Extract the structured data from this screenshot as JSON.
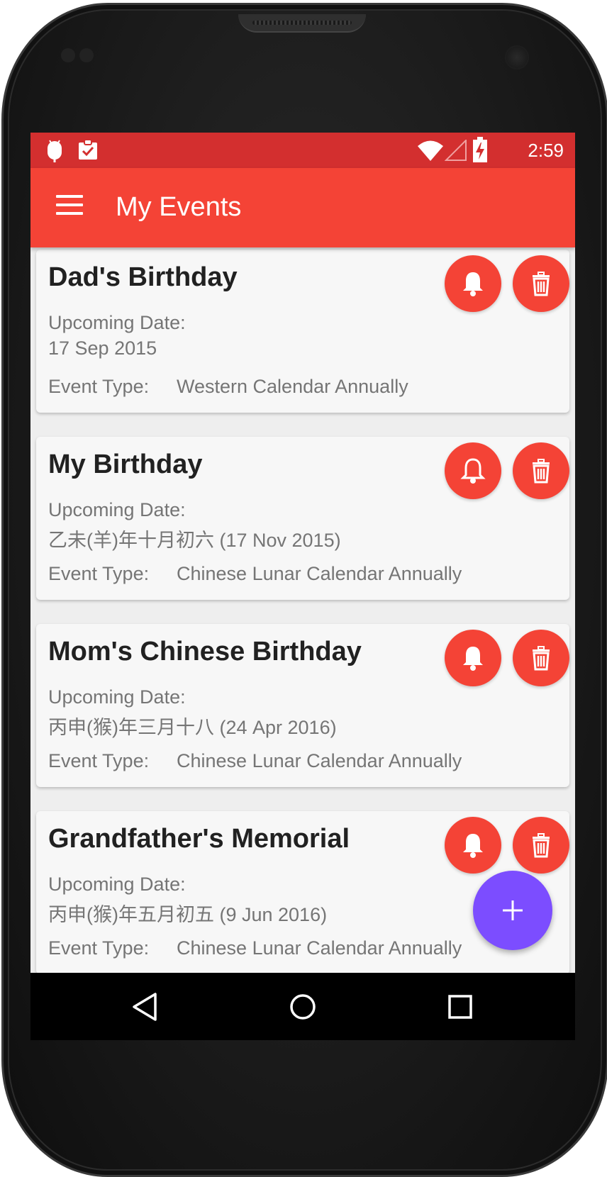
{
  "status_bar": {
    "time": "2:59",
    "icons": [
      "android-debug-icon",
      "clipboard-check-icon",
      "wifi-icon",
      "signal-icon",
      "battery-charging-icon"
    ]
  },
  "app_bar": {
    "title": "My Events",
    "menu_icon": "hamburger-menu-icon"
  },
  "events": [
    {
      "title": "Dad's Birthday",
      "date_label": "Upcoming Date:",
      "date_value": "17 Sep 2015",
      "type_label": "Event Type:",
      "type_value": "Western Calendar Annually"
    },
    {
      "title": "My Birthday",
      "date_label": "Upcoming Date:",
      "date_value": "乙未(羊)年十月初六 (17 Nov 2015)",
      "type_label": "Event Type:",
      "type_value": "Chinese Lunar Calendar Annually"
    },
    {
      "title": "Mom's Chinese Birthday",
      "date_label": "Upcoming Date:",
      "date_value": "丙申(猴)年三月十八 (24 Apr 2016)",
      "type_label": "Event Type:",
      "type_value": "Chinese Lunar Calendar Annually"
    },
    {
      "title": "Grandfather's Memorial",
      "date_label": "Upcoming Date:",
      "date_value": "丙申(猴)年五月初五 (9 Jun 2016)",
      "type_label": "Event Type:",
      "type_value": "Chinese Lunar Calendar Annually"
    }
  ],
  "card_actions": {
    "reminder_icon": "bell-icon",
    "delete_icon": "trash-icon"
  },
  "fab": {
    "icon": "plus-icon"
  },
  "nav_bar": {
    "icons": [
      "back-icon",
      "home-icon",
      "recents-icon"
    ]
  },
  "colors": {
    "status_bar": "#d32f2f",
    "app_bar": "#f44336",
    "action_button": "#f44336",
    "fab": "#7c4dff",
    "card_background": "#f7f7f7",
    "list_background": "#eeeeee"
  }
}
